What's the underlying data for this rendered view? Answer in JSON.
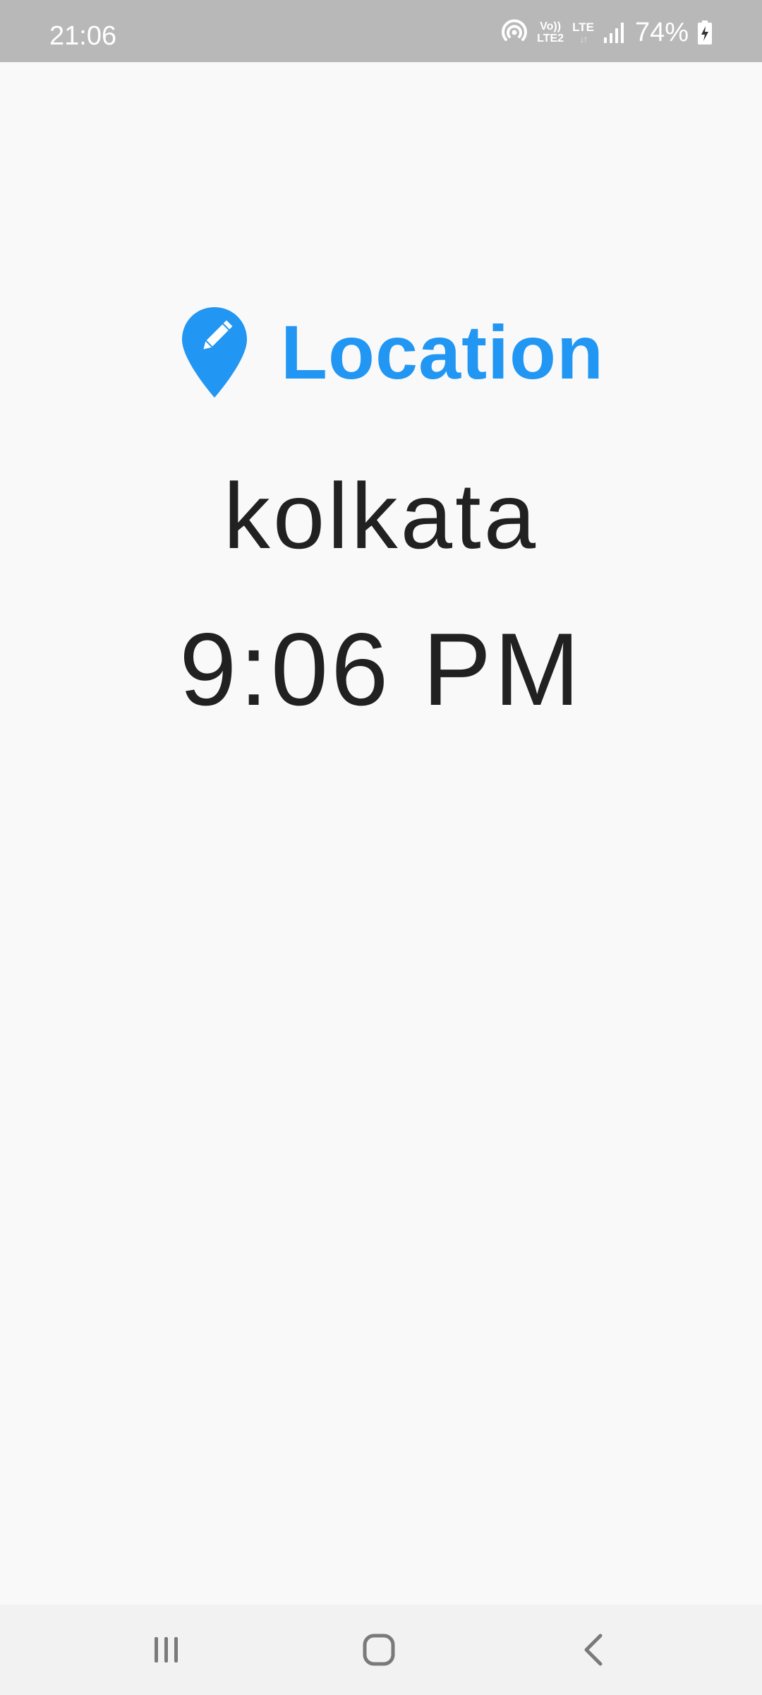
{
  "status_bar": {
    "time": "21:06",
    "volte_top": "Vo))",
    "volte_bottom": "LTE2",
    "network_type": "LTE",
    "data_arrows": "↓↑",
    "battery_percent": "74%",
    "icons": [
      "hotspot-icon",
      "signal-icon",
      "battery-charging-icon"
    ]
  },
  "main": {
    "edit_location": {
      "label": "Location",
      "icon": "location-edit-icon",
      "color": "#2196f3"
    },
    "location_name": "kolkata",
    "time": "9:06 PM"
  },
  "nav_bar": {
    "buttons": [
      "recents-icon",
      "home-icon",
      "back-icon"
    ]
  }
}
